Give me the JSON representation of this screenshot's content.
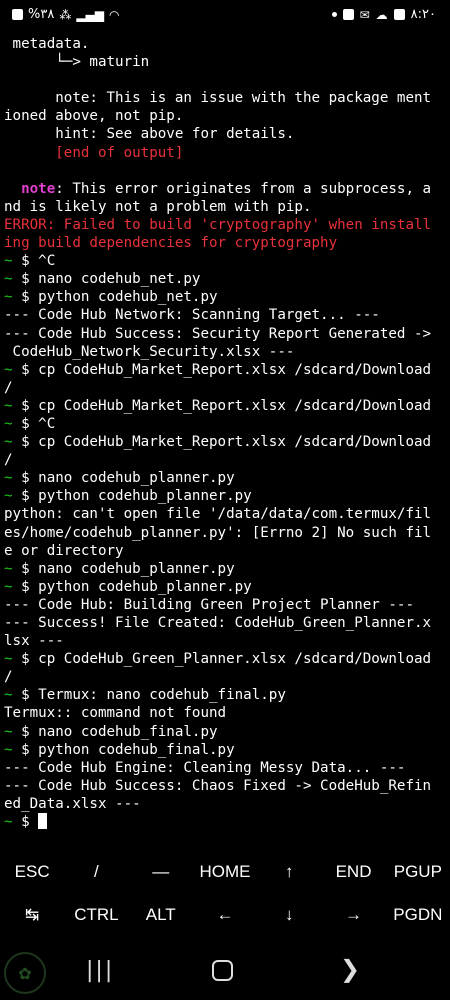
{
  "status_bar": {
    "left_text": "%۳۸",
    "right_time": "۸:۲۰",
    "left_icons": [
      "sim-icon",
      "volte-signal-icon",
      "signal-bars-icon",
      "wifi-icon"
    ],
    "right_icons": [
      "notification-dot-icon",
      "facebook-icon",
      "mail-icon",
      "cloud-icon",
      "gallery-icon"
    ]
  },
  "terminal": {
    "lines": [
      [
        {
          "t": " metadata.",
          "c": "white"
        }
      ],
      [
        {
          "t": "      └─> maturin",
          "c": "white"
        }
      ],
      [
        {
          "t": "",
          "c": "white"
        }
      ],
      [
        {
          "t": "      note: This is an issue with the package ment",
          "c": "white"
        }
      ],
      [
        {
          "t": "ioned above, not pip.",
          "c": "white"
        }
      ],
      [
        {
          "t": "      hint: See above for details.",
          "c": "white"
        }
      ],
      [
        {
          "t": "      [end of output]",
          "c": "red"
        }
      ],
      [
        {
          "t": "",
          "c": "white"
        }
      ],
      [
        {
          "t": "  ",
          "c": "white"
        },
        {
          "t": "note",
          "c": "magenta"
        },
        {
          "t": ": This error originates from a subprocess, a",
          "c": "white"
        }
      ],
      [
        {
          "t": "nd is likely not a problem with pip.",
          "c": "white"
        }
      ],
      [
        {
          "t": "ERROR: Failed to build 'cryptography' when install",
          "c": "red"
        }
      ],
      [
        {
          "t": "ing build dependencies for cryptography",
          "c": "red"
        }
      ],
      [
        {
          "t": "~ ",
          "c": "green"
        },
        {
          "t": "$ ^C",
          "c": "white"
        }
      ],
      [
        {
          "t": "~ ",
          "c": "green"
        },
        {
          "t": "$ nano codehub_net.py",
          "c": "white"
        }
      ],
      [
        {
          "t": "~ ",
          "c": "green"
        },
        {
          "t": "$ python codehub_net.py",
          "c": "white"
        }
      ],
      [
        {
          "t": "--- Code Hub Network: Scanning Target... ---",
          "c": "white"
        }
      ],
      [
        {
          "t": "--- Code Hub Success: Security Report Generated ->",
          "c": "white"
        }
      ],
      [
        {
          "t": " CodeHub_Network_Security.xlsx ---",
          "c": "white"
        }
      ],
      [
        {
          "t": "~ ",
          "c": "green"
        },
        {
          "t": "$ cp CodeHub_Market_Report.xlsx /sdcard/Download",
          "c": "white"
        }
      ],
      [
        {
          "t": "/",
          "c": "white"
        }
      ],
      [
        {
          "t": "~ ",
          "c": "green"
        },
        {
          "t": "$ cp CodeHub_Market_Report.xlsx /sdcard/Download",
          "c": "white"
        }
      ],
      [
        {
          "t": "~ ",
          "c": "green"
        },
        {
          "t": "$ ^C",
          "c": "white"
        }
      ],
      [
        {
          "t": "~ ",
          "c": "green"
        },
        {
          "t": "$ cp CodeHub_Market_Report.xlsx /sdcard/Download",
          "c": "white"
        }
      ],
      [
        {
          "t": "/",
          "c": "white"
        }
      ],
      [
        {
          "t": "~ ",
          "c": "green"
        },
        {
          "t": "$ nano codehub_planner.py",
          "c": "white"
        }
      ],
      [
        {
          "t": "~ ",
          "c": "green"
        },
        {
          "t": "$ python codehub_planner.py",
          "c": "white"
        }
      ],
      [
        {
          "t": "python: can't open file '/data/data/com.termux/fil",
          "c": "white"
        }
      ],
      [
        {
          "t": "es/home/codehub_planner.py': [Errno 2] No such fil",
          "c": "white"
        }
      ],
      [
        {
          "t": "e or directory",
          "c": "white"
        }
      ],
      [
        {
          "t": "~ ",
          "c": "green"
        },
        {
          "t": "$ nano codehub_planner.py",
          "c": "white"
        }
      ],
      [
        {
          "t": "~ ",
          "c": "green"
        },
        {
          "t": "$ python codehub_planner.py",
          "c": "white"
        }
      ],
      [
        {
          "t": "--- Code Hub: Building Green Project Planner ---",
          "c": "white"
        }
      ],
      [
        {
          "t": "--- Success! File Created: CodeHub_Green_Planner.x",
          "c": "white"
        }
      ],
      [
        {
          "t": "lsx ---",
          "c": "white"
        }
      ],
      [
        {
          "t": "~ ",
          "c": "green"
        },
        {
          "t": "$ cp CodeHub_Green_Planner.xlsx /sdcard/Download",
          "c": "white"
        }
      ],
      [
        {
          "t": "/",
          "c": "white"
        }
      ],
      [
        {
          "t": "~ ",
          "c": "green"
        },
        {
          "t": "$ Termux: nano codehub_final.py",
          "c": "white"
        }
      ],
      [
        {
          "t": "Termux:: command not found",
          "c": "white"
        }
      ],
      [
        {
          "t": "~ ",
          "c": "green"
        },
        {
          "t": "$ nano codehub_final.py",
          "c": "white"
        }
      ],
      [
        {
          "t": "~ ",
          "c": "green"
        },
        {
          "t": "$ python codehub_final.py",
          "c": "white"
        }
      ],
      [
        {
          "t": "--- Code Hub Engine: Cleaning Messy Data... ---",
          "c": "white"
        }
      ],
      [
        {
          "t": "--- Code Hub Success: Chaos Fixed -> CodeHub_Refin",
          "c": "white"
        }
      ],
      [
        {
          "t": "ed_Data.xlsx ---",
          "c": "white"
        }
      ],
      [
        {
          "t": "~ ",
          "c": "green"
        },
        {
          "t": "$ ",
          "c": "white"
        }
      ]
    ]
  },
  "extra_keys": {
    "row1": [
      "ESC",
      "/",
      "—",
      "HOME",
      "↑",
      "END",
      "PGUP"
    ],
    "row2": [
      "↹",
      "CTRL",
      "ALT",
      "←",
      "↓",
      "→",
      "PGDN"
    ]
  },
  "navbar": {
    "recent_glyph": "|||",
    "back_glyph": "❯"
  },
  "colors": {
    "background": "#000000",
    "text": "#ffffff",
    "error": "#e8313a",
    "prompt": "#19c819",
    "note": "#e040d0"
  }
}
